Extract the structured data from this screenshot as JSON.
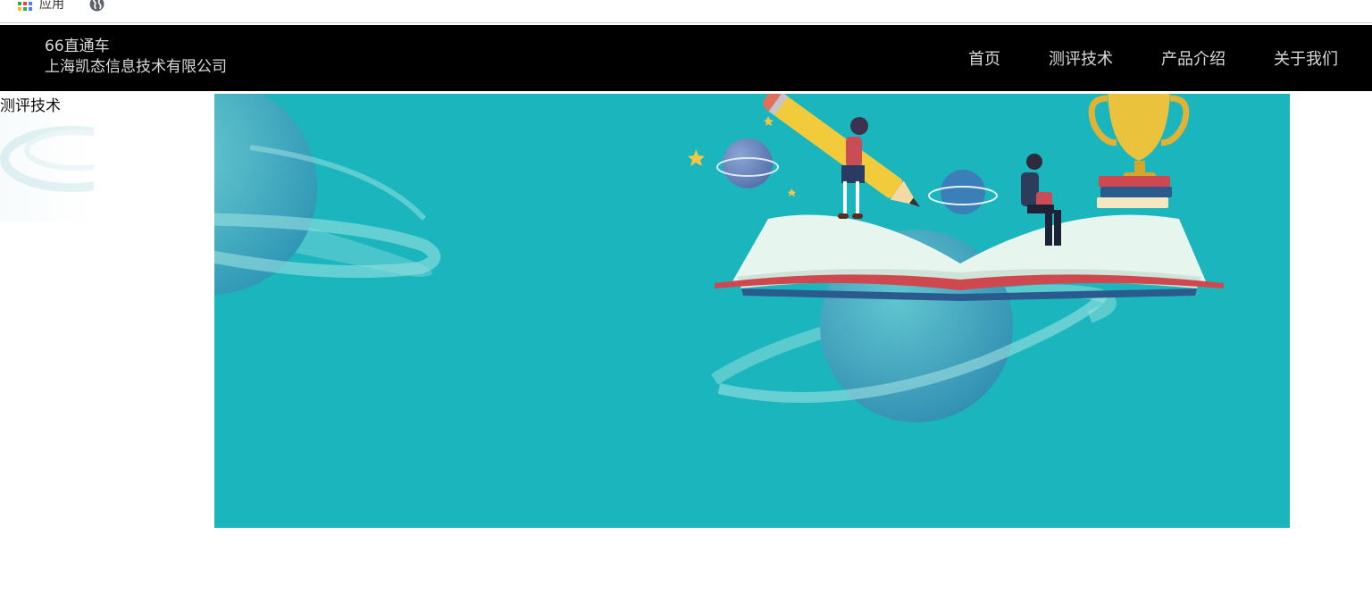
{
  "bookmarks_bar": {
    "apps_label": "应用",
    "apps_icon": "apps-grid-icon",
    "globe_icon": "globe-icon"
  },
  "header": {
    "brand_line1": "66直通车",
    "brand_line2": "上海凯态信息技术有限公司",
    "nav": [
      {
        "label": "首页"
      },
      {
        "label": "测评技术"
      },
      {
        "label": "产品介绍"
      },
      {
        "label": "关于我们"
      }
    ]
  },
  "content": {
    "section_label": "测评技术"
  },
  "colors": {
    "nav_bg": "#000000",
    "banner_bg": "#1bb6bd",
    "nav_text": "#d9d9d9"
  }
}
